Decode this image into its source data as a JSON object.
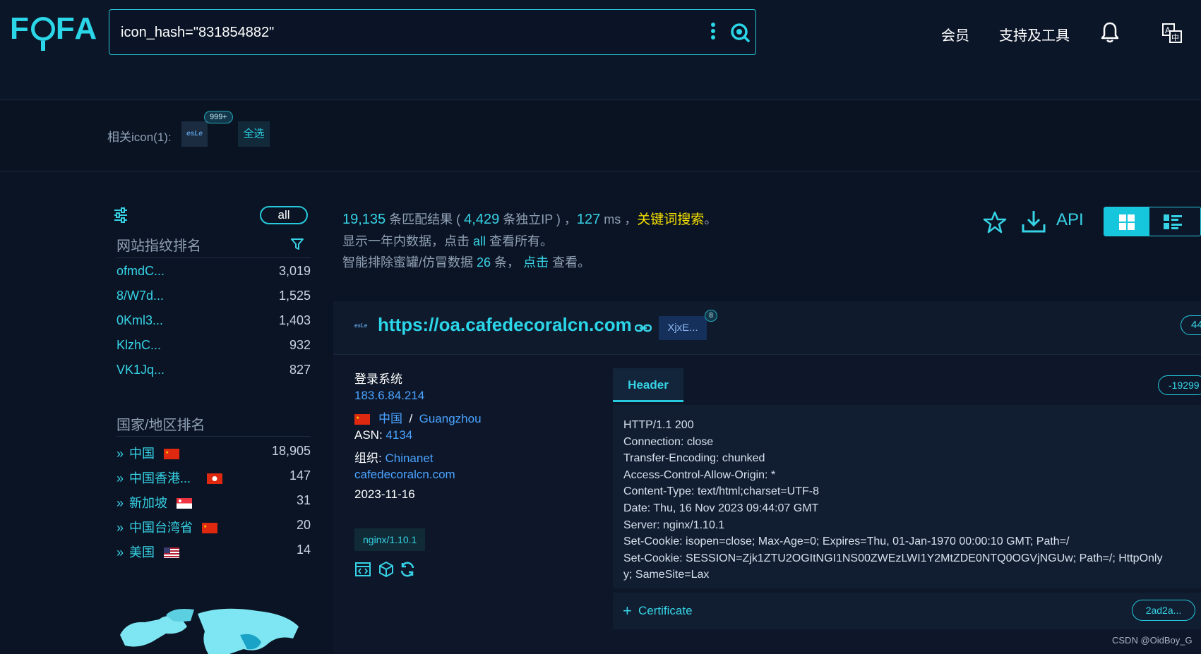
{
  "header": {
    "logo": "FOFA",
    "search_value": "icon_hash=\"831854882\"",
    "nav": [
      "会员",
      "支持及工具"
    ]
  },
  "icon_bar": {
    "label": "相关icon(1):",
    "icon_text": "esLe",
    "badge": "999+",
    "select_all": "全选"
  },
  "sidebar": {
    "all_label": "all",
    "fingerprint_title": "网站指纹排名",
    "fingerprints": [
      {
        "name": "ofmdC...",
        "count": "3,019"
      },
      {
        "name": "8/W7d...",
        "count": "1,525"
      },
      {
        "name": "0Kml3...",
        "count": "1,403"
      },
      {
        "name": "KlzhC...",
        "count": "932"
      },
      {
        "name": "VK1Jq...",
        "count": "827"
      }
    ],
    "country_title": "国家/地区排名",
    "countries": [
      {
        "name": "中国",
        "count": "18,905",
        "flag": "cn"
      },
      {
        "name": "中国香港...",
        "count": "147",
        "flag": "hk"
      },
      {
        "name": "新加坡",
        "count": "31",
        "flag": "sg"
      },
      {
        "name": "中国台湾省",
        "count": "20",
        "flag": "cn"
      },
      {
        "name": "美国",
        "count": "14",
        "flag": "us"
      }
    ]
  },
  "stats": {
    "total": "19,135",
    "total_suffix": " 条匹配结果 ( ",
    "unique_ip": "4,429",
    "unique_ip_suffix": " 条独立IP ) ，",
    "time": "127",
    "time_suffix": " ms ，",
    "keyword": "关键词搜索",
    "period": "。",
    "line2_a": "显示一年内数据，点击 ",
    "line2_all": "all",
    "line2_b": " 查看所有。",
    "line3_a": "智能排除蜜罐/仿冒数据 ",
    "line3_num": "26",
    "line3_b": " 条，",
    "line3_click": "点击",
    "line3_c": " 查看。",
    "api_label": "API"
  },
  "result": {
    "favicon_text": "esLe",
    "url": "https://oa.cafedecoralcn.com",
    "tag": "XjxE...",
    "tag_badge": "8",
    "right_pill": "44",
    "title": "登录系统",
    "ip": "183.6.84.214",
    "country": "中国",
    "city": "Guangzhou",
    "asn_label": "ASN:",
    "asn": "4134",
    "org_label": "组织:",
    "org": "Chinanet",
    "domain": "cafedecoralcn.com",
    "date": "2023-11-16",
    "server": "nginx/1.10.1",
    "header_tab": "Header",
    "header_pill": "-19299",
    "header_lines": [
      "HTTP/1.1 200",
      "Connection: close",
      "Transfer-Encoding: chunked",
      "Access-Control-Allow-Origin: *",
      "Content-Type: text/html;charset=UTF-8",
      "Date: Thu, 16 Nov 2023 09:44:07 GMT",
      "Server: nginx/1.10.1",
      "Set-Cookie: isopen=close; Max-Age=0; Expires=Thu, 01-Jan-1970 00:00:10 GMT; Path=/",
      "Set-Cookie: SESSION=Zjk1ZTU2OGItNGI1NS00ZWEzLWI1Y2MtZDE0NTQ0OGVjNGUw; Path=/; HttpOnly",
      "y; SameSite=Lax"
    ],
    "cert_label": "Certificate",
    "cert_pill": "2ad2a..."
  },
  "watermark": "CSDN @OidBoy_G"
}
